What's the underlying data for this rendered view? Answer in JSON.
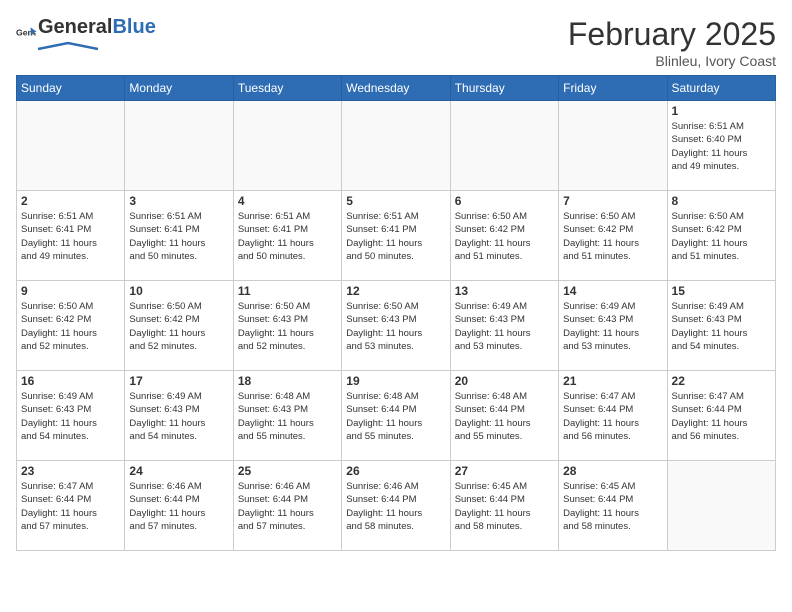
{
  "header": {
    "logo_general": "General",
    "logo_blue": "Blue",
    "month_year": "February 2025",
    "location": "Blinleu, Ivory Coast"
  },
  "days_of_week": [
    "Sunday",
    "Monday",
    "Tuesday",
    "Wednesday",
    "Thursday",
    "Friday",
    "Saturday"
  ],
  "weeks": [
    [
      {
        "day": "",
        "info": ""
      },
      {
        "day": "",
        "info": ""
      },
      {
        "day": "",
        "info": ""
      },
      {
        "day": "",
        "info": ""
      },
      {
        "day": "",
        "info": ""
      },
      {
        "day": "",
        "info": ""
      },
      {
        "day": "1",
        "info": "Sunrise: 6:51 AM\nSunset: 6:40 PM\nDaylight: 11 hours\nand 49 minutes."
      }
    ],
    [
      {
        "day": "2",
        "info": "Sunrise: 6:51 AM\nSunset: 6:41 PM\nDaylight: 11 hours\nand 49 minutes."
      },
      {
        "day": "3",
        "info": "Sunrise: 6:51 AM\nSunset: 6:41 PM\nDaylight: 11 hours\nand 50 minutes."
      },
      {
        "day": "4",
        "info": "Sunrise: 6:51 AM\nSunset: 6:41 PM\nDaylight: 11 hours\nand 50 minutes."
      },
      {
        "day": "5",
        "info": "Sunrise: 6:51 AM\nSunset: 6:41 PM\nDaylight: 11 hours\nand 50 minutes."
      },
      {
        "day": "6",
        "info": "Sunrise: 6:50 AM\nSunset: 6:42 PM\nDaylight: 11 hours\nand 51 minutes."
      },
      {
        "day": "7",
        "info": "Sunrise: 6:50 AM\nSunset: 6:42 PM\nDaylight: 11 hours\nand 51 minutes."
      },
      {
        "day": "8",
        "info": "Sunrise: 6:50 AM\nSunset: 6:42 PM\nDaylight: 11 hours\nand 51 minutes."
      }
    ],
    [
      {
        "day": "9",
        "info": "Sunrise: 6:50 AM\nSunset: 6:42 PM\nDaylight: 11 hours\nand 52 minutes."
      },
      {
        "day": "10",
        "info": "Sunrise: 6:50 AM\nSunset: 6:42 PM\nDaylight: 11 hours\nand 52 minutes."
      },
      {
        "day": "11",
        "info": "Sunrise: 6:50 AM\nSunset: 6:43 PM\nDaylight: 11 hours\nand 52 minutes."
      },
      {
        "day": "12",
        "info": "Sunrise: 6:50 AM\nSunset: 6:43 PM\nDaylight: 11 hours\nand 53 minutes."
      },
      {
        "day": "13",
        "info": "Sunrise: 6:49 AM\nSunset: 6:43 PM\nDaylight: 11 hours\nand 53 minutes."
      },
      {
        "day": "14",
        "info": "Sunrise: 6:49 AM\nSunset: 6:43 PM\nDaylight: 11 hours\nand 53 minutes."
      },
      {
        "day": "15",
        "info": "Sunrise: 6:49 AM\nSunset: 6:43 PM\nDaylight: 11 hours\nand 54 minutes."
      }
    ],
    [
      {
        "day": "16",
        "info": "Sunrise: 6:49 AM\nSunset: 6:43 PM\nDaylight: 11 hours\nand 54 minutes."
      },
      {
        "day": "17",
        "info": "Sunrise: 6:49 AM\nSunset: 6:43 PM\nDaylight: 11 hours\nand 54 minutes."
      },
      {
        "day": "18",
        "info": "Sunrise: 6:48 AM\nSunset: 6:43 PM\nDaylight: 11 hours\nand 55 minutes."
      },
      {
        "day": "19",
        "info": "Sunrise: 6:48 AM\nSunset: 6:44 PM\nDaylight: 11 hours\nand 55 minutes."
      },
      {
        "day": "20",
        "info": "Sunrise: 6:48 AM\nSunset: 6:44 PM\nDaylight: 11 hours\nand 55 minutes."
      },
      {
        "day": "21",
        "info": "Sunrise: 6:47 AM\nSunset: 6:44 PM\nDaylight: 11 hours\nand 56 minutes."
      },
      {
        "day": "22",
        "info": "Sunrise: 6:47 AM\nSunset: 6:44 PM\nDaylight: 11 hours\nand 56 minutes."
      }
    ],
    [
      {
        "day": "23",
        "info": "Sunrise: 6:47 AM\nSunset: 6:44 PM\nDaylight: 11 hours\nand 57 minutes."
      },
      {
        "day": "24",
        "info": "Sunrise: 6:46 AM\nSunset: 6:44 PM\nDaylight: 11 hours\nand 57 minutes."
      },
      {
        "day": "25",
        "info": "Sunrise: 6:46 AM\nSunset: 6:44 PM\nDaylight: 11 hours\nand 57 minutes."
      },
      {
        "day": "26",
        "info": "Sunrise: 6:46 AM\nSunset: 6:44 PM\nDaylight: 11 hours\nand 58 minutes."
      },
      {
        "day": "27",
        "info": "Sunrise: 6:45 AM\nSunset: 6:44 PM\nDaylight: 11 hours\nand 58 minutes."
      },
      {
        "day": "28",
        "info": "Sunrise: 6:45 AM\nSunset: 6:44 PM\nDaylight: 11 hours\nand 58 minutes."
      },
      {
        "day": "",
        "info": ""
      }
    ]
  ]
}
